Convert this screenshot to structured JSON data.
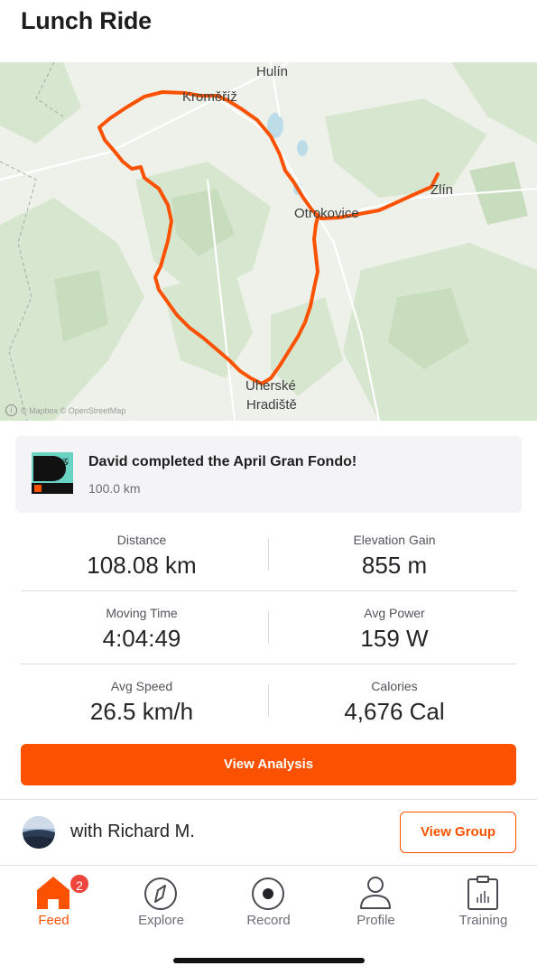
{
  "header": {
    "title": "Lunch Ride"
  },
  "map": {
    "labels": {
      "hulin": "Hulín",
      "kromeriz": "Kroměříž",
      "zlin": "Zlín",
      "otrokovice": "Otrokovice",
      "uherske1": "Uherské",
      "uherske2": "Hradiště"
    },
    "attribution": "© Mapbox © OpenStreetMap",
    "route_color": "#fc5200"
  },
  "challenge": {
    "title": "David completed the April Gran Fondo!",
    "distance": "100.0 km"
  },
  "stats": {
    "distance": {
      "label": "Distance",
      "value": "108.08 km"
    },
    "elevation": {
      "label": "Elevation Gain",
      "value": "855 m"
    },
    "moving_time": {
      "label": "Moving Time",
      "value": "4:04:49"
    },
    "avg_power": {
      "label": "Avg Power",
      "value": "159 W"
    },
    "avg_speed": {
      "label": "Avg Speed",
      "value": "26.5 km/h"
    },
    "calories": {
      "label": "Calories",
      "value": "4,676 Cal"
    }
  },
  "actions": {
    "view_analysis": "View Analysis",
    "with_text": "with Richard M.",
    "view_group": "View Group"
  },
  "tabbar": {
    "tabs": [
      {
        "label": "Feed",
        "icon": "home-icon",
        "active": true,
        "badge": "2"
      },
      {
        "label": "Explore",
        "icon": "compass-icon"
      },
      {
        "label": "Record",
        "icon": "record-icon"
      },
      {
        "label": "Profile",
        "icon": "profile-icon"
      },
      {
        "label": "Training",
        "icon": "training-icon"
      }
    ]
  },
  "colors": {
    "accent": "#fc5200",
    "badge": "#f0453c"
  }
}
